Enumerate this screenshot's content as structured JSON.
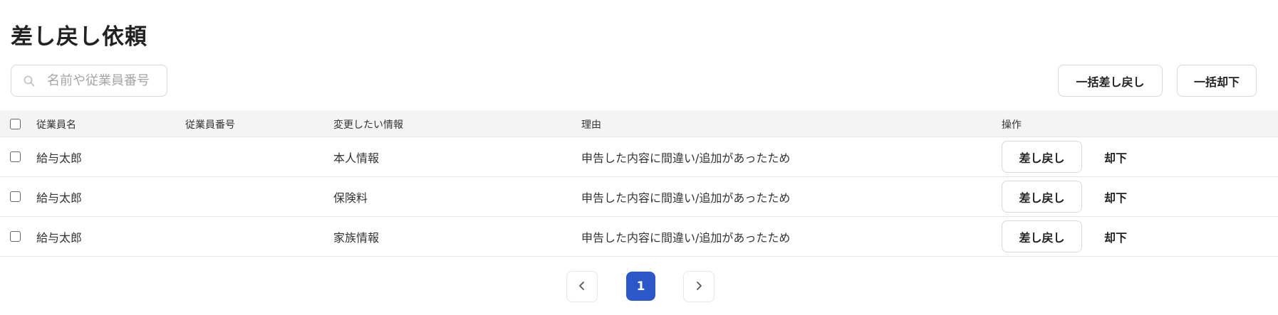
{
  "page": {
    "title": "差し戻し依頼"
  },
  "search": {
    "placeholder": "名前や従業員番号",
    "value": ""
  },
  "toolbar": {
    "bulk_return_label": "一括差し戻し",
    "bulk_reject_label": "一括却下"
  },
  "table": {
    "headers": {
      "name": "従業員名",
      "number": "従業員番号",
      "info": "変更したい情報",
      "reason": "理由",
      "operation": "操作"
    },
    "rows": [
      {
        "name": "給与太郎",
        "number": "",
        "info": "本人情報",
        "reason": "申告した内容に間違い/追加があったため",
        "return_label": "差し戻し",
        "reject_label": "却下"
      },
      {
        "name": "給与太郎",
        "number": "",
        "info": "保険料",
        "reason": "申告した内容に間違い/追加があったため",
        "return_label": "差し戻し",
        "reject_label": "却下"
      },
      {
        "name": "給与太郎",
        "number": "",
        "info": "家族情報",
        "reason": "申告した内容に間違い/追加があったため",
        "return_label": "差し戻し",
        "reject_label": "却下"
      }
    ]
  },
  "pagination": {
    "current_page": "1"
  },
  "icons": {
    "search": "search-icon",
    "prev": "chevron-left-icon",
    "next": "chevron-right-icon"
  },
  "colors": {
    "accent": "#2c57c9",
    "header_bg": "#f5f4f4",
    "border": "#d9d9d9"
  }
}
